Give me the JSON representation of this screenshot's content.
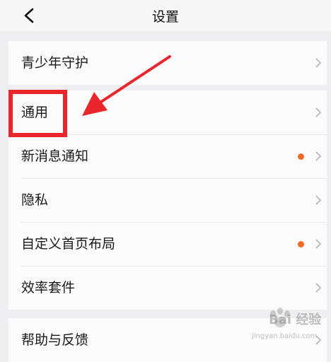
{
  "header": {
    "title": "设置"
  },
  "groups": {
    "g1": {
      "items": [
        {
          "label": "青少年守护"
        }
      ]
    },
    "g2": {
      "items": [
        {
          "label": "通用"
        },
        {
          "label": "新消息通知",
          "badge": true
        },
        {
          "label": "隐私"
        },
        {
          "label": "自定义首页布局",
          "badge": true
        },
        {
          "label": "效率套件"
        }
      ]
    },
    "g3": {
      "items": [
        {
          "label": "帮助与反馈"
        }
      ]
    }
  },
  "icons": {
    "back": "chevron-left-icon",
    "row": "chevron-right-icon"
  },
  "colors": {
    "badge": "#f06a28",
    "annotation": "#e8262b"
  },
  "watermark": {
    "brand": "Bai 经验",
    "url": "jingyan.baidu.com"
  }
}
